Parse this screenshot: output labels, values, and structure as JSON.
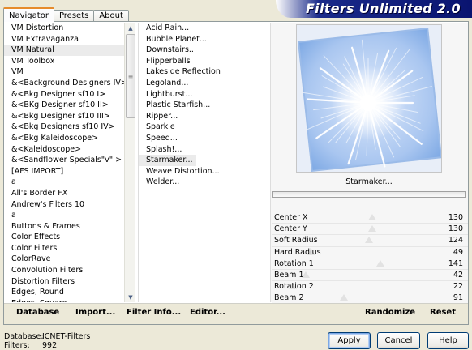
{
  "tabs": [
    "Navigator",
    "Presets",
    "About"
  ],
  "banner": {
    "title": "Filters Unlimited 2.0"
  },
  "categories": [
    "VM Distortion",
    "VM Extravaganza",
    "VM Natural",
    "VM Toolbox",
    "VM",
    "&<Background Designers IV>",
    "&<Bkg Designer sf10 I>",
    "&<BKg Designer sf10 II>",
    "&<Bkg Designer sf10 III>",
    "&<Bkg Designers sf10 IV>",
    "&<Bkg Kaleidoscope>",
    "&<Kaleidoscope>",
    "&<Sandflower Specials\"v\" >",
    "[AFS IMPORT]",
    "a",
    "All's Border FX",
    "Andrew's Filters 10",
    "a",
    "Buttons & Frames",
    "Color Effects",
    "Color Filters",
    "ColorRave",
    "Convolution Filters",
    "Distortion Filters",
    "Edges, Round",
    "Edges, Square"
  ],
  "selected_category_index": 2,
  "filters": [
    "Acid Rain...",
    "Bubble Planet...",
    "Downstairs...",
    "Flipperballs",
    "Lakeside Reflection",
    "Legoland...",
    "Lightburst...",
    "Plastic Starfish...",
    "Ripper...",
    "Sparkle",
    "Speed...",
    "Splash!...",
    "Starmaker...",
    "Weave Distortion...",
    "Welder..."
  ],
  "selected_filter_index": 12,
  "preview": {
    "filter_name": "Starmaker...",
    "colors": {
      "base": "#bcd5f5",
      "burst": "#ffffff",
      "edge": "#7ea9e4"
    }
  },
  "params": [
    {
      "name": "Center X",
      "value": "130",
      "level": 0.51
    },
    {
      "name": "Center Y",
      "value": "130",
      "level": 0.51
    },
    {
      "name": "Soft Radius",
      "value": "124",
      "level": 0.49
    },
    {
      "name": "Hard Radius",
      "value": "49",
      "level": 0.19
    },
    {
      "name": "Rotation 1",
      "value": "141",
      "level": 0.55
    },
    {
      "name": "Beam 1",
      "value": "42",
      "level": 0.16
    },
    {
      "name": "Rotation 2",
      "value": "22",
      "level": 0.09
    },
    {
      "name": "Beam 2",
      "value": "91",
      "level": 0.36
    }
  ],
  "toolbar": {
    "database": "Database",
    "import": "Import...",
    "filter_info": "Filter Info...",
    "editor": "Editor...",
    "randomize": "Randomize",
    "reset": "Reset"
  },
  "status": {
    "database_label": "Database:",
    "database_value": "ICNET-Filters",
    "filters_label": "Filters:",
    "filters_value": "992"
  },
  "buttons": {
    "apply": "Apply",
    "cancel": "Cancel",
    "help": "Help"
  }
}
